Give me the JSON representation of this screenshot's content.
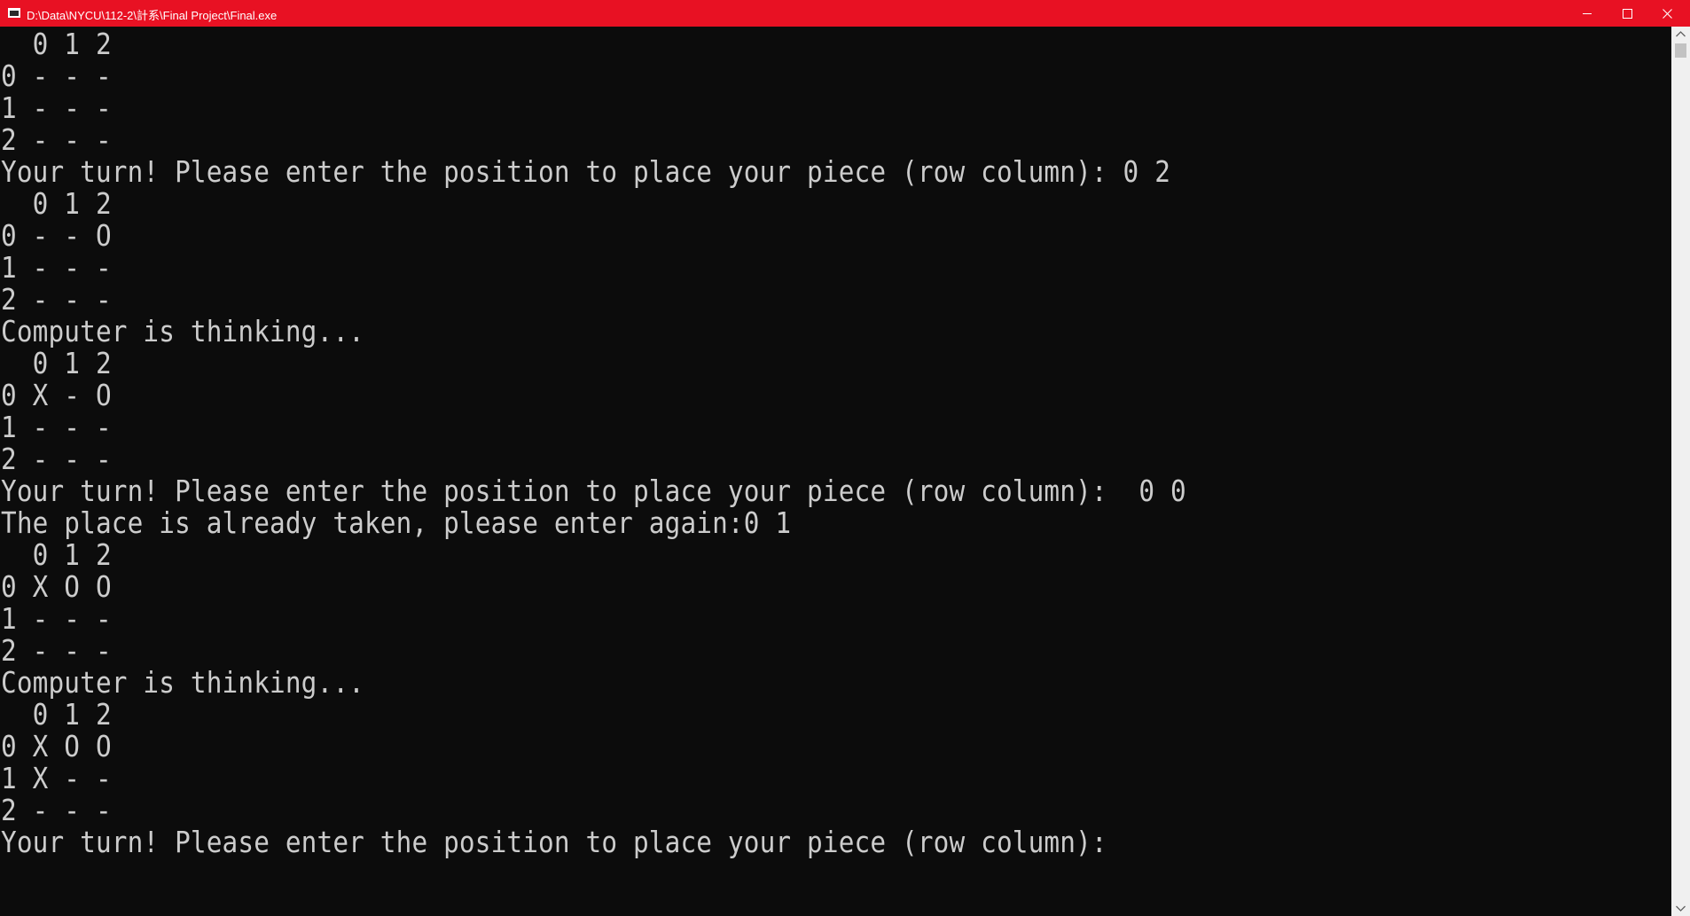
{
  "window": {
    "title": "D:\\Data\\NYCU\\112-2\\計系\\Final Project\\Final.exe",
    "titlebar_color": "#e81123",
    "console_bg": "#0c0c0c",
    "text_color": "#cccccc"
  },
  "titlebar": {
    "app_icon": "console-app-icon",
    "buttons": [
      "minimize-icon",
      "maximize-icon",
      "close-icon"
    ]
  },
  "console": {
    "lines": [
      "  0 1 2",
      "0 - - -",
      "1 - - -",
      "2 - - -",
      "Your turn! Please enter the position to place your piece (row column): 0 2",
      "  0 1 2",
      "0 - - O",
      "1 - - -",
      "2 - - -",
      "Computer is thinking...",
      "  0 1 2",
      "0 X - O",
      "1 - - -",
      "2 - - -",
      "Your turn! Please enter the position to place your piece (row column):  0 0",
      "The place is already taken, please enter again:0 1",
      "  0 1 2",
      "0 X O O",
      "1 - - -",
      "2 - - -",
      "Computer is thinking...",
      "  0 1 2",
      "0 X O O",
      "1 X - -",
      "2 - - -",
      "Your turn! Please enter the position to place your piece (row column):"
    ]
  },
  "scrollbar": {
    "up_icon": "scroll-up-arrow-icon",
    "down_icon": "scroll-down-arrow-icon"
  }
}
